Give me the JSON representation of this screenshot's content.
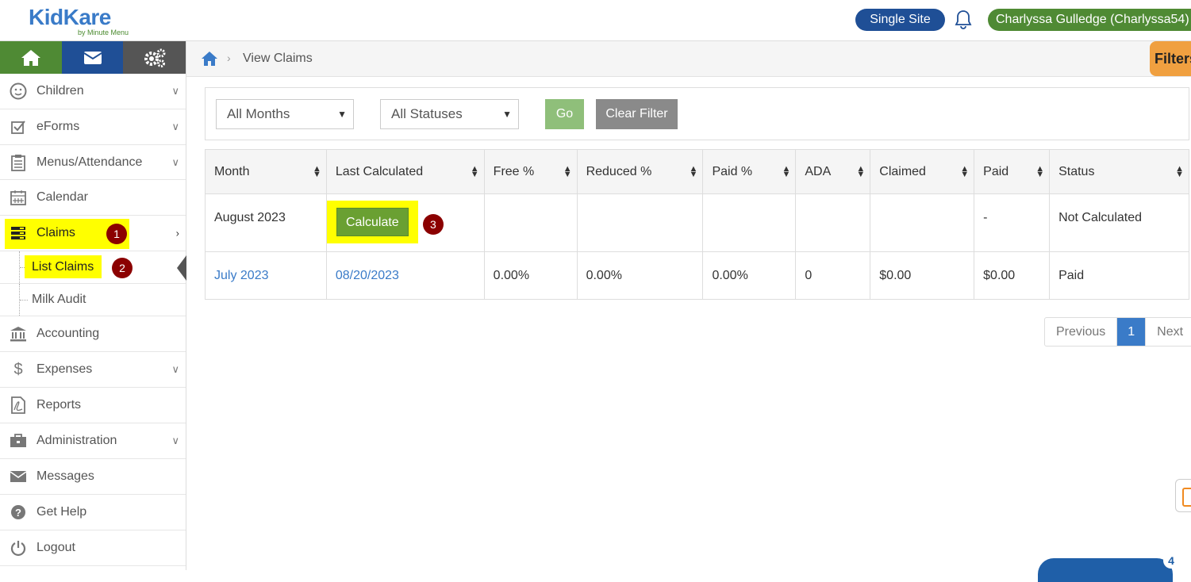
{
  "header": {
    "logo_text": "KidKare",
    "logo_tagline": "by Minute Menu",
    "site_button": "Single Site",
    "user_label": "Charlyssa Gulledge (Charlyssa54)"
  },
  "colors": {
    "green": "#4f8a34",
    "navy": "#1f4f96",
    "highlight": "#ffff00",
    "badge": "#8b0000",
    "link": "#3a7bc8",
    "filters_tab": "#f0a040"
  },
  "sidebar": {
    "tab_icons": [
      "home-icon",
      "envelope-icon",
      "gears-icon"
    ],
    "items": [
      {
        "label": "Children",
        "icon": "smiley-icon",
        "expandable": true
      },
      {
        "label": "eForms",
        "icon": "check-square-icon",
        "expandable": true
      },
      {
        "label": "Menus/Attendance",
        "icon": "clipboard-icon",
        "expandable": true
      },
      {
        "label": "Calendar",
        "icon": "calendar-icon",
        "expandable": false
      },
      {
        "label": "Claims",
        "icon": "claims-icon",
        "expanded": true
      },
      {
        "label": "Accounting",
        "icon": "bank-icon",
        "expandable": false
      },
      {
        "label": "Expenses",
        "icon": "dollar-icon",
        "expandable": true
      },
      {
        "label": "Reports",
        "icon": "pdf-file-icon",
        "expandable": false
      },
      {
        "label": "Administration",
        "icon": "briefcase-icon",
        "expandable": true
      },
      {
        "label": "Messages",
        "icon": "envelope-icon",
        "expandable": false
      },
      {
        "label": "Get Help",
        "icon": "question-icon",
        "expandable": false
      },
      {
        "label": "Logout",
        "icon": "power-icon",
        "expandable": false
      }
    ],
    "claims_sub": [
      {
        "label": "List Claims",
        "active": true
      },
      {
        "label": "Milk Audit",
        "active": false
      }
    ]
  },
  "steps": {
    "one": "1",
    "two": "2",
    "three": "3"
  },
  "breadcrumb": {
    "current": "View Claims"
  },
  "filters_tab": "Filters",
  "filters": {
    "month_select": "All Months",
    "status_select": "All Statuses",
    "go": "Go",
    "clear": "Clear Filter"
  },
  "table": {
    "columns": [
      "Month",
      "Last Calculated",
      "Free %",
      "Reduced %",
      "Paid %",
      "ADA",
      "Claimed",
      "Paid",
      "Status"
    ],
    "rows": [
      {
        "month": "August 2023",
        "action": "Calculate",
        "free": "",
        "reduced": "",
        "paid_pct": "",
        "ada": "",
        "claimed": "",
        "paid": "-",
        "status": "Not Calculated"
      },
      {
        "month": "July 2023",
        "last_calculated": "08/20/2023",
        "free": "0.00%",
        "reduced": "0.00%",
        "paid_pct": "0.00%",
        "ada": "0",
        "claimed": "$0.00",
        "paid": "$0.00",
        "status": "Paid"
      }
    ]
  },
  "pagination": {
    "previous": "Previous",
    "current": "1",
    "next": "Next"
  },
  "chat": {
    "count": "4"
  }
}
